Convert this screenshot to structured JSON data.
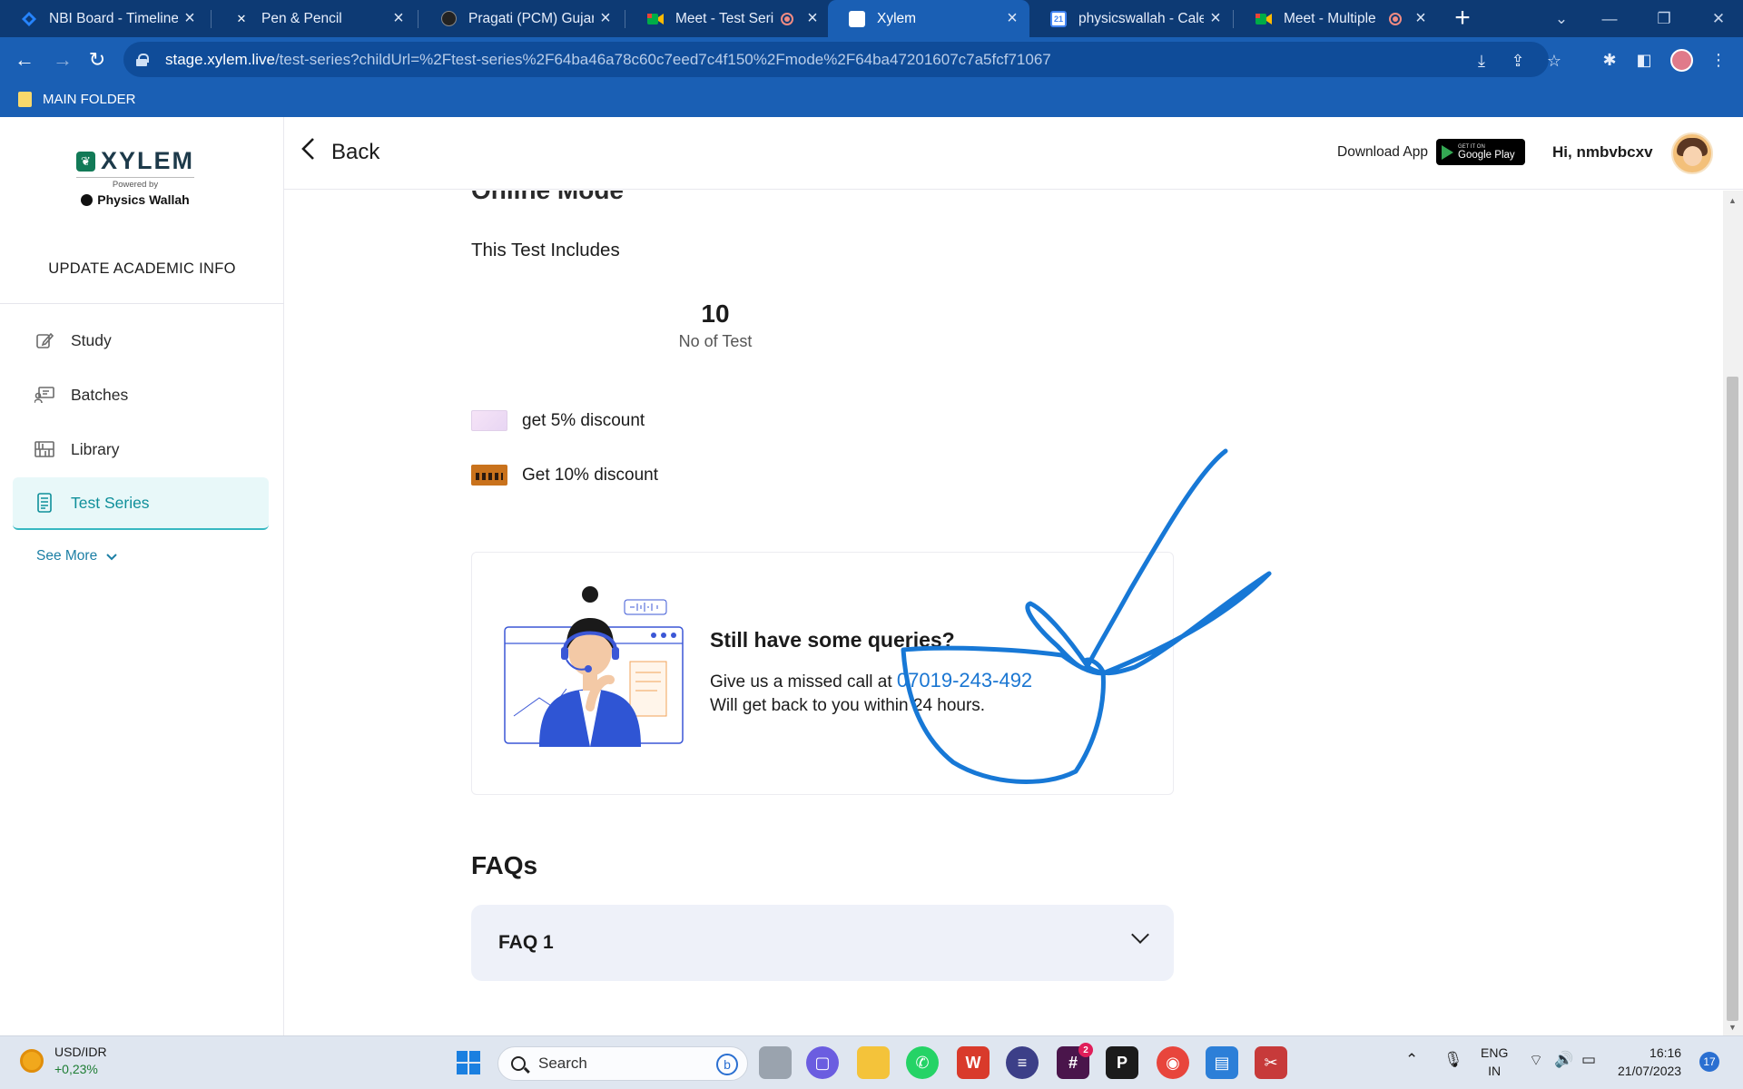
{
  "browser": {
    "tabs": [
      {
        "title": "NBI Board - Timeline",
        "icon": "jira-icon",
        "color": "#2684ff"
      },
      {
        "title": "Pen & Pencil",
        "icon": "x-icon",
        "color": "#ffffff"
      },
      {
        "title": "Pragati (PCM) Gujarat",
        "icon": "pw-icon",
        "color": "#222222"
      },
      {
        "title": "Meet - Test Series",
        "icon": "meet-icon",
        "color": "#00ac47",
        "recording": true
      },
      {
        "title": "Xylem",
        "icon": "xylem-icon",
        "color": "#ffffff",
        "active": true
      },
      {
        "title": "physicswallah - Calendar",
        "icon": "calendar-icon",
        "color": "#4285f4",
        "badge": "21"
      },
      {
        "title": "Meet - Multiple",
        "icon": "meet-icon",
        "color": "#00ac47",
        "recording": true
      }
    ],
    "url_host": "stage.xylem.live",
    "url_path": "/test-series?childUrl=%2Ftest-series%2F64ba46a78c60c7eed7c4f150%2Fmode%2F64ba47201607c7a5fcf71067",
    "bookmark_folder": "MAIN FOLDER"
  },
  "sidebar": {
    "brand": "XYLEM",
    "powered_by": "Powered by",
    "partner": "Physics Wallah",
    "update_info": "UPDATE ACADEMIC INFO",
    "items": [
      {
        "label": "Study",
        "icon": "pencil-square-icon"
      },
      {
        "label": "Batches",
        "icon": "presentation-icon"
      },
      {
        "label": "Library",
        "icon": "bookshelf-icon"
      },
      {
        "label": "Test Series",
        "icon": "document-list-icon",
        "active": true
      }
    ],
    "see_more": "See More"
  },
  "header": {
    "back_label": "Back",
    "download_app": "Download App",
    "google_play_small": "GET IT ON",
    "google_play": "Google Play",
    "greeting": "Hi, nmbvbcxv"
  },
  "content": {
    "mode_heading": "Online Mode",
    "includes_heading": "This Test Includes",
    "stat_value": "10",
    "stat_label": "No of Test",
    "offers": [
      {
        "label": "get 5% discount"
      },
      {
        "label": "Get 10% discount"
      }
    ],
    "query": {
      "title": "Still have some queries?",
      "line1_prefix": "Give us a missed call at ",
      "phone": "07019-243-492",
      "line2": "Will get back to you within 24 hours."
    },
    "faq_heading": "FAQs",
    "faqs": [
      {
        "question": "FAQ 1"
      }
    ]
  },
  "colors": {
    "brand_blue": "#1a5fb4",
    "tab_bar": "#0d3a74",
    "active_nav": "#0f8f9a",
    "annotation_ink": "#1778d6"
  },
  "taskbar": {
    "widget_title": "USD/IDR",
    "widget_change": "+0,23%",
    "search_placeholder": "Search",
    "lang_line1": "ENG",
    "lang_line2": "IN",
    "time": "16:16",
    "date": "21/07/2023",
    "notifications": "17",
    "slack_badge": "2"
  }
}
